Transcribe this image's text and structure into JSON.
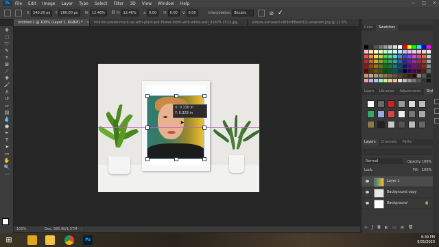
{
  "menu": {
    "logo": "Ps",
    "items": [
      "File",
      "Edit",
      "Image",
      "Layer",
      "Type",
      "Select",
      "Filter",
      "3D",
      "View",
      "Window",
      "Help"
    ],
    "window_controls": [
      "—",
      "□",
      "✕"
    ]
  },
  "options": {
    "x_label": "X:",
    "x_value": "240.20 px",
    "y_label": "Y:",
    "y_value": "200.00 px",
    "w_label": "W:",
    "w_value": "12.46%",
    "h_label": "H:",
    "h_value": "12.46%",
    "angle_value": "0.00",
    "hskew_label": "H:",
    "hskew_value": "0.00",
    "vskew_label": "V:",
    "vskew_value": "0.00",
    "interp_label": "Interpolation:",
    "interp_value": "Bicubic",
    "cancel_icon": "cancel-icon",
    "commit_icon": "commit-check-icon"
  },
  "tabs": [
    {
      "label": "Untitled-1 @ 100% (Layer 1, RGB/8) *",
      "active": true
    },
    {
      "label": "interior-poster-mock-up-with-plant-pot-flower-room-with-white-wall_41470-1513.jpg",
      "active": false
    },
    {
      "label": "alireza-esmaeeli-vW8mE8oeb1Q-unsplash.jpg @ 12.5%",
      "active": false
    }
  ],
  "transform_info": {
    "x": "X: 0.130 in",
    "y": "Y: 0.329 in"
  },
  "status": {
    "zoom": "100%",
    "doc": "Doc: 585.9K/1.57M"
  },
  "swatches_panel": {
    "tabs": [
      "Color",
      "Swatches"
    ]
  },
  "libraries_panel": {
    "tabs": [
      "Learn",
      "Libraries",
      "Adjustments",
      "Styles"
    ]
  },
  "layers_panel": {
    "tabs": [
      "Layers",
      "Channels",
      "Paths"
    ],
    "blend_mode": "Normal",
    "opacity_label": "Opacity:",
    "opacity_value": "100%",
    "lock_label": "Lock:",
    "fill_label": "Fill:",
    "fill_value": "100%",
    "layers": [
      {
        "name": "Layer 1",
        "selected": true
      },
      {
        "name": "Background copy",
        "selected": false
      },
      {
        "name": "Background",
        "selected": false
      }
    ]
  },
  "taskbar": {
    "time": "9:39 PM",
    "date": "8/31/2020"
  },
  "colors": {
    "accent": "#2fa3f7",
    "guide": "#c060c8",
    "panel_bg": "#383838",
    "canvas_bg": "#262626"
  }
}
